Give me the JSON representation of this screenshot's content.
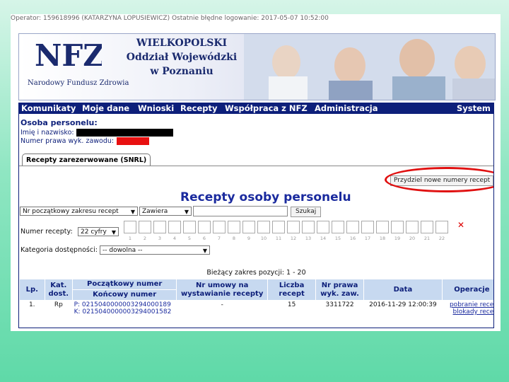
{
  "operator_line": "Operator: 159618996 (KATARZYNA LOPUSIEWICZ) Ostatnie błędne logowanie: 2017-05-07 10:52:00",
  "banner": {
    "logo": "NFZ",
    "logo_subtitle": "Narodowy Fundusz Zdrowia",
    "org_line1": "WIELKOPOLSKI",
    "org_line2": "Oddział Wojewódzki",
    "org_line3": "w Poznaniu"
  },
  "menu": {
    "items": [
      "Komunikaty",
      "Moje dane",
      "Wnioski",
      "Recepty",
      "Współpraca z NFZ",
      "Administracja"
    ],
    "right": "System"
  },
  "person": {
    "title": "Osoba personelu:",
    "name_label": "Imię i nazwisko:",
    "license_label": "Numer prawa wyk. zawodu:"
  },
  "tabs": [
    "Recepty zarezerwowane (SNRL)"
  ],
  "assign_button": "Przydziel nowe numery recept",
  "heading": "Recepty osoby personelu",
  "search": {
    "field_select": "Nr początkowy zakresu recept",
    "mode_select": "Zawiera",
    "query_value": "",
    "search_button": "Szukaj"
  },
  "recipe_number": {
    "label": "Numer recepty:",
    "digits_select": "22 cyfry",
    "positions": [
      "1",
      "2",
      "3",
      "4",
      "5",
      "6",
      "7",
      "8",
      "9",
      "10",
      "11",
      "12",
      "13",
      "14",
      "15",
      "16",
      "17",
      "18",
      "19",
      "20",
      "21",
      "22"
    ],
    "clear_icon": "close-icon"
  },
  "category": {
    "label": "Kategoria dostępności:",
    "value": "-- dowolna --"
  },
  "range_text": "Bieżący zakres pozycji: 1 - 20",
  "table": {
    "headers": {
      "lp": "Lp.",
      "kat": "Kat. dost.",
      "start": "Początkowy numer",
      "end": "Końcowy numer",
      "contract": "Nr umowy na wystawianie recepty",
      "count": "Liczba recept",
      "license": "Nr prawa wyk. zaw.",
      "date": "Data",
      "ops": "Operacje"
    },
    "rows": [
      {
        "lp": "1.",
        "kat": "Rp",
        "start": "P: 0215040000003294000189",
        "end": "K: 0215040000003294001582",
        "contract": "-",
        "count": "15",
        "license": "3311722",
        "date": "2016-11-29 12:00:39",
        "op1": "pobranie recept",
        "op2": "blokady recept"
      }
    ]
  },
  "colors": {
    "navy": "#0d1f7a",
    "header_bg": "#c7d9f0",
    "annotation_red": "#e01010"
  }
}
